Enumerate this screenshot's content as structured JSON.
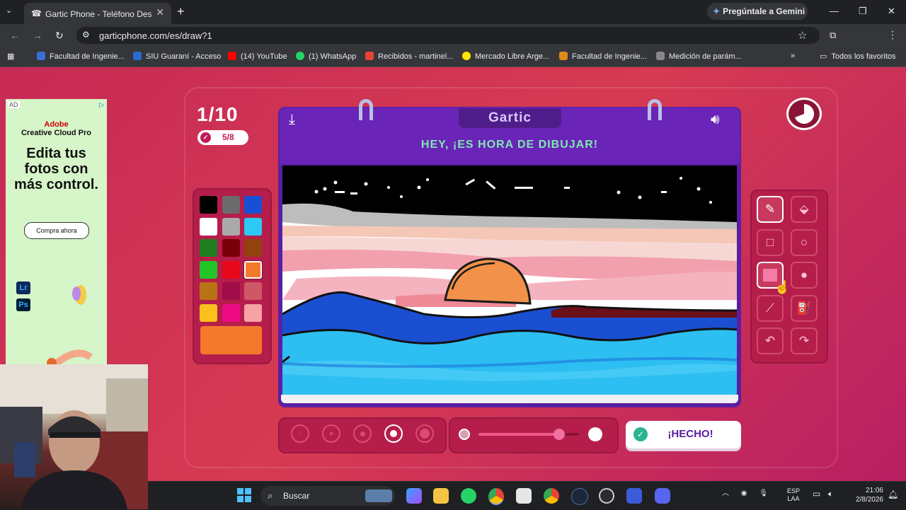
{
  "browser": {
    "tab_title": "Gartic Phone - Teléfono Descon",
    "tab_icon": "☎",
    "gemini_label": "Pregúntale a Gemini",
    "url": "garticphone.com/es/draw?1",
    "bookmarks": [
      {
        "label": "Facultad de Ingenie...",
        "color": "#3b6fd8"
      },
      {
        "label": "SIU Guaraní - Acceso",
        "color": "#2a6bd1"
      },
      {
        "label": "(14) YouTube",
        "color": "#ff0000"
      },
      {
        "label": "(1) WhatsApp",
        "color": "#25d366"
      },
      {
        "label": "Recibidos - martinel...",
        "color": "#ea4335"
      },
      {
        "label": "Mercado Libre Arge...",
        "color": "#ffe600"
      },
      {
        "label": "Facultad de Ingenie...",
        "color": "#e08a1e"
      },
      {
        "label": "Medición de parám...",
        "color": "#888888"
      }
    ],
    "all_bookmarks": "Todos los favoritos"
  },
  "ad": {
    "tag": "AD",
    "brand_line1": "Adobe",
    "brand_line2": "Creative Cloud Pro",
    "headline": "Edita tus fotos con más control.",
    "cta": "Compra ahora",
    "app_icons": [
      "Lr",
      "Ps"
    ]
  },
  "game": {
    "round": "1/10",
    "progress": "5/8",
    "logo": "Gartic",
    "prompt": "HEY, ¡ES HORA DE DIBUJAR!",
    "done_label": "¡HECHO!",
    "selected_color": "#f4792d",
    "palette": [
      [
        "#000000",
        "#6b6b6b",
        "#1650d4"
      ],
      [
        "#ffffff",
        "#aaaaaa",
        "#2ec8f5"
      ],
      [
        "#1f7d1f",
        "#7a0008",
        "#92420f"
      ],
      [
        "#22c42a",
        "#e8081a",
        "#f4792d"
      ],
      [
        "#b87316",
        "#a10d48",
        "#cf5866"
      ],
      [
        "#fac01c",
        "#ee0c84",
        "#f7a2a4"
      ]
    ],
    "tools": [
      {
        "name": "pencil-tool",
        "icon": "✎"
      },
      {
        "name": "eraser-tool",
        "icon": "⬙"
      },
      {
        "name": "rectangle-tool",
        "icon": "□"
      },
      {
        "name": "ellipse-tool",
        "icon": "○"
      },
      {
        "name": "filled-rectangle-tool",
        "icon": "■"
      },
      {
        "name": "filled-ellipse-tool",
        "icon": "●"
      },
      {
        "name": "line-tool",
        "icon": "⟋"
      },
      {
        "name": "fill-bucket-tool",
        "icon": "⛽"
      },
      {
        "name": "undo-tool",
        "icon": "↶"
      },
      {
        "name": "redo-tool",
        "icon": "↷"
      }
    ],
    "brush_sizes_selected_index": 3,
    "opacity_level": 0.8
  },
  "taskbar": {
    "search_placeholder": "Buscar",
    "lang_line1": "ESP",
    "lang_line2": "LAA",
    "time": "21:06",
    "date": "2/8/2026"
  }
}
